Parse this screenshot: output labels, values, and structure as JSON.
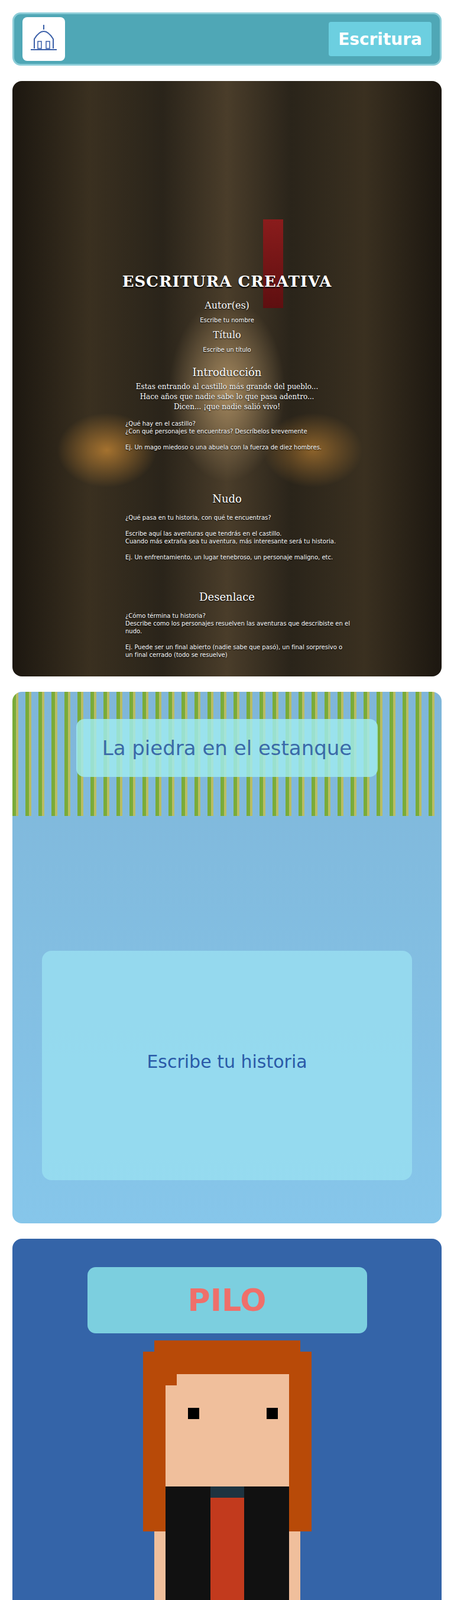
{
  "header": {
    "button": {
      "label": "Escritura"
    }
  },
  "worksheet": {
    "title": "ESCRITURA CREATIVA",
    "fields": [
      {
        "label": "Autor(es)",
        "hint": "Escribe tu nombre"
      },
      {
        "label": "Título",
        "hint": "Escribe un título"
      }
    ],
    "sections": [
      {
        "heading": "Introducción",
        "lead": [
          "Estas entrando al castillo más grande del pueblo...",
          "Hace años que nadie sabe lo que pasa adentro...",
          "Dicen... ¡que nadie salió vivo!"
        ],
        "paragraphs": [
          [
            "¿Qué hay en el castillo?",
            "¿Con qué personajes te encuentras? Descríbelos brevemente"
          ],
          [
            "Ej. Un mago miedoso o una abuela con la fuerza de diez hombres."
          ]
        ]
      },
      {
        "heading": "Nudo",
        "lead": [],
        "paragraphs": [
          [
            "¿Qué pasa en tu historia, con qué te encuentras?"
          ],
          [
            "Escribe aquí las aventuras que tendrás en el castillo.",
            "Cuando más extraña sea tu aventura, más interesante será tu historia."
          ],
          [
            "Ej. Un enfrentamiento, un lugar tenebroso, un personaje maligno, etc."
          ]
        ]
      },
      {
        "heading": "Desenlace",
        "lead": [],
        "paragraphs": [
          [
            "¿Cómo términa tu historia?",
            "Describe como los personajes resuelven las aventuras que describiste en el nudo."
          ],
          [
            "Ej. Puede ser un final abierto (nadie sabe que pasó), un final sorpresivo o un final cerrado (todo se resuelve)"
          ]
        ]
      }
    ]
  },
  "story": {
    "title": "La piedra en el estanque",
    "placeholder": "Escribe tu historia"
  },
  "character": {
    "name": "PILO"
  }
}
